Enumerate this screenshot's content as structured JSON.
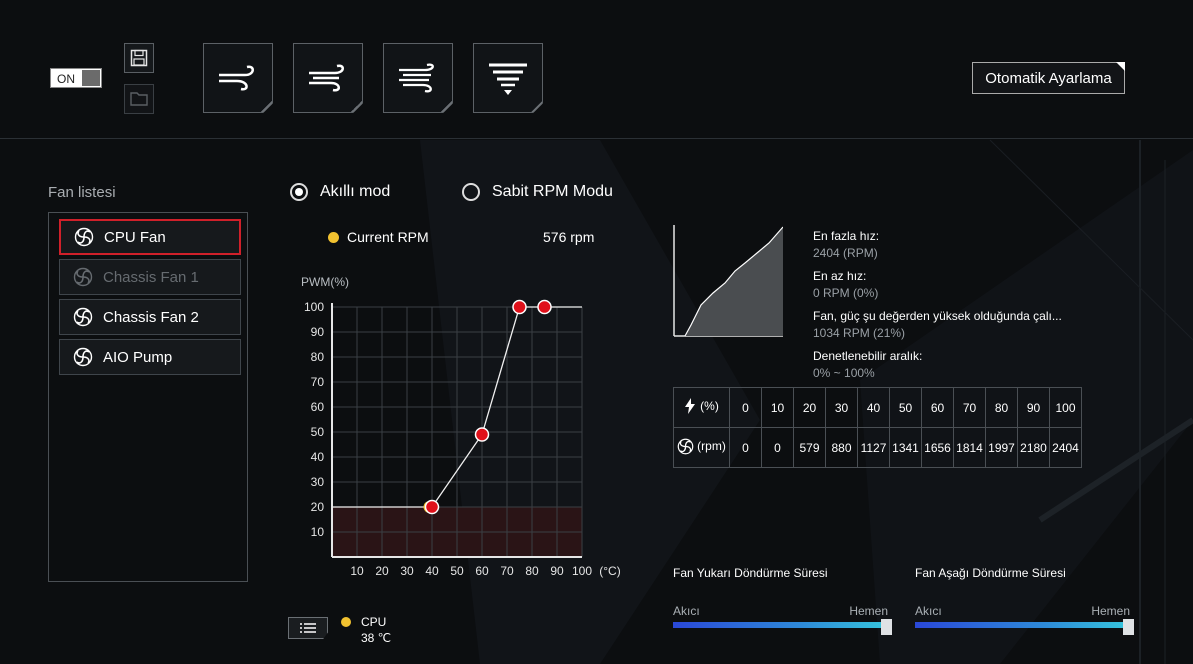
{
  "toolbar": {
    "power_toggle": "ON",
    "save_icon": "save-icon",
    "open_icon": "folder-icon",
    "modes": [
      "fan-mode-silent-icon",
      "fan-mode-standard-icon",
      "fan-mode-turbo-icon",
      "fan-mode-fullspeed-icon"
    ],
    "auto_tune_label": "Otomatik Ayarlama"
  },
  "fan_list": {
    "title": "Fan listesi",
    "items": [
      {
        "label": "CPU Fan",
        "state": "active"
      },
      {
        "label": "Chassis Fan 1",
        "state": "disabled"
      },
      {
        "label": "Chassis Fan 2",
        "state": "normal"
      },
      {
        "label": "AIO Pump",
        "state": "normal"
      }
    ]
  },
  "modes": {
    "smart": "Akıllı mod",
    "fixed": "Sabit RPM Modu",
    "selected": "smart"
  },
  "current": {
    "label": "Current RPM",
    "value": "576 rpm"
  },
  "chart_data": {
    "type": "line",
    "ylabel": "PWM(%)",
    "xunit": "(°C)",
    "xlim": [
      0,
      100
    ],
    "ylim": [
      0,
      100
    ],
    "x_ticks": [
      "10",
      "20",
      "30",
      "40",
      "50",
      "60",
      "70",
      "80",
      "90",
      "100"
    ],
    "y_ticks": [
      "100",
      "90",
      "80",
      "70",
      "60",
      "50",
      "40",
      "30",
      "20",
      "10"
    ],
    "series": [
      {
        "x": [
          0,
          40,
          60,
          75,
          85,
          100
        ],
        "y": [
          20,
          20,
          49,
          100,
          100,
          100
        ]
      }
    ],
    "points": [
      {
        "x": 40,
        "y": 20
      },
      {
        "x": 60,
        "y": 49
      },
      {
        "x": 75,
        "y": 100
      },
      {
        "x": 85,
        "y": 100
      }
    ],
    "current_temp": {
      "x": 39,
      "y": 20
    },
    "shaded_below": 20
  },
  "legend": {
    "icon": "list-icon",
    "sensor": "CPU",
    "temp": "38 ℃"
  },
  "fan_info": {
    "max_label": "En fazla hız:",
    "max_value": "2404 (RPM)",
    "min_label": "En az hız:",
    "min_value": "0 RPM (0%)",
    "start_label": "Fan, güç şu değerden yüksek olduğunda çalı...",
    "start_value": "1034 RPM (21%)",
    "range_label": "Denetlenebilir aralık:",
    "range_value": "0% ~ 100%"
  },
  "rpm_table": {
    "power_header": "(%)",
    "rpm_header": "(rpm)",
    "percent": [
      "0",
      "10",
      "20",
      "30",
      "40",
      "50",
      "60",
      "70",
      "80",
      "90",
      "100"
    ],
    "rpm": [
      "0",
      "0",
      "579",
      "880",
      "1127",
      "1341",
      "1656",
      "1814",
      "1997",
      "2180",
      "2404"
    ]
  },
  "spin_up": {
    "title": "Fan Yukarı Döndürme Süresi",
    "left": "Akıcı",
    "right": "Hemen",
    "value_percent": 100
  },
  "spin_down": {
    "title": "Fan Aşağı Döndürme Süresi",
    "left": "Akıcı",
    "right": "Hemen",
    "value_percent": 100
  },
  "colors": {
    "accent_red": "#d0202a",
    "point_red": "#e0101a",
    "current_yellow": "#f2c230"
  }
}
